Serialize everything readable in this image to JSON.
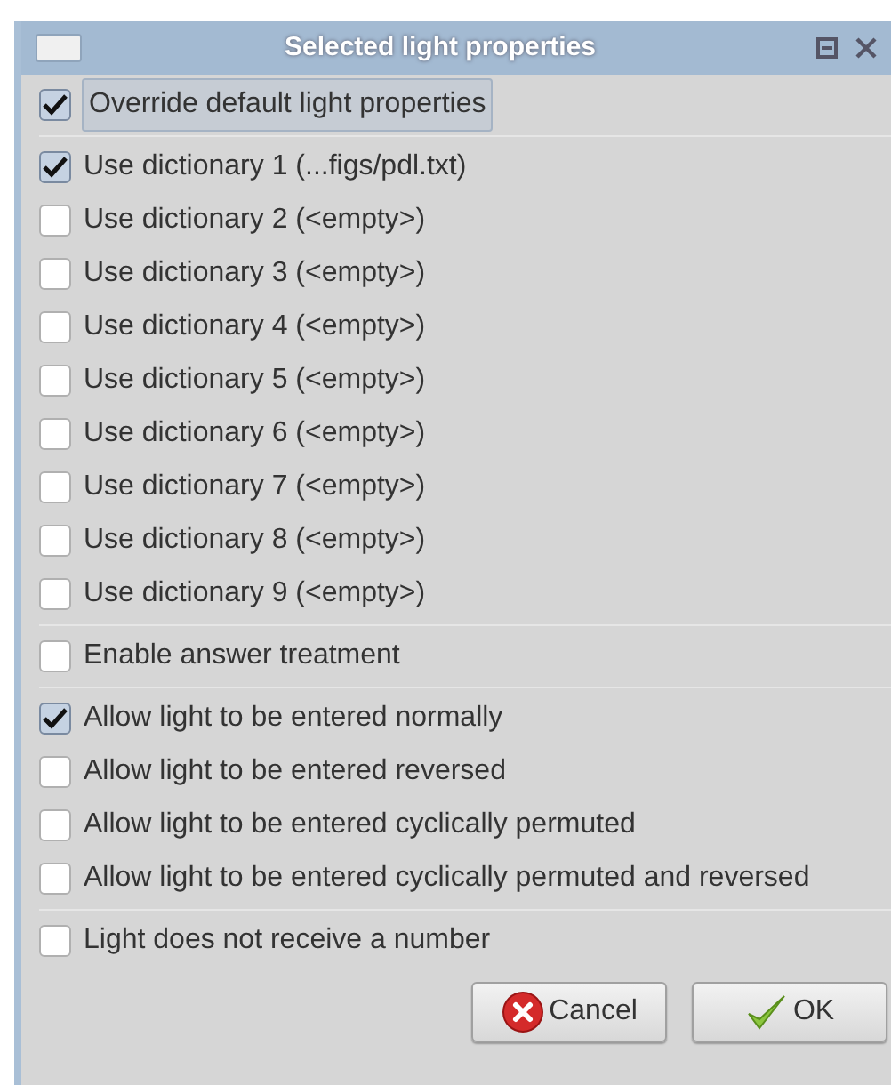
{
  "window": {
    "title": "Selected light properties"
  },
  "sections": [
    {
      "items": [
        {
          "label": "Override default light properties",
          "checked": true,
          "focused": true
        }
      ]
    },
    {
      "items": [
        {
          "label": "Use dictionary 1 (...figs/pdl.txt)",
          "checked": true,
          "focused": false
        },
        {
          "label": "Use dictionary 2 (<empty>)",
          "checked": false,
          "focused": false
        },
        {
          "label": "Use dictionary 3 (<empty>)",
          "checked": false,
          "focused": false
        },
        {
          "label": "Use dictionary 4 (<empty>)",
          "checked": false,
          "focused": false
        },
        {
          "label": "Use dictionary 5 (<empty>)",
          "checked": false,
          "focused": false
        },
        {
          "label": "Use dictionary 6 (<empty>)",
          "checked": false,
          "focused": false
        },
        {
          "label": "Use dictionary 7 (<empty>)",
          "checked": false,
          "focused": false
        },
        {
          "label": "Use dictionary 8 (<empty>)",
          "checked": false,
          "focused": false
        },
        {
          "label": "Use dictionary 9 (<empty>)",
          "checked": false,
          "focused": false
        }
      ]
    },
    {
      "items": [
        {
          "label": "Enable answer treatment",
          "checked": false,
          "focused": false
        }
      ]
    },
    {
      "items": [
        {
          "label": "Allow light to be entered normally",
          "checked": true,
          "focused": false
        },
        {
          "label": "Allow light to be entered reversed",
          "checked": false,
          "focused": false
        },
        {
          "label": "Allow light to be entered cyclically permuted",
          "checked": false,
          "focused": false
        },
        {
          "label": "Allow light to be entered cyclically permuted and reversed",
          "checked": false,
          "focused": false
        }
      ]
    },
    {
      "items": [
        {
          "label": "Light does not receive a number",
          "checked": false,
          "focused": false
        }
      ]
    }
  ],
  "buttons": [
    {
      "label": "Cancel",
      "kind": "cancel"
    },
    {
      "label": "OK",
      "kind": "ok"
    }
  ]
}
